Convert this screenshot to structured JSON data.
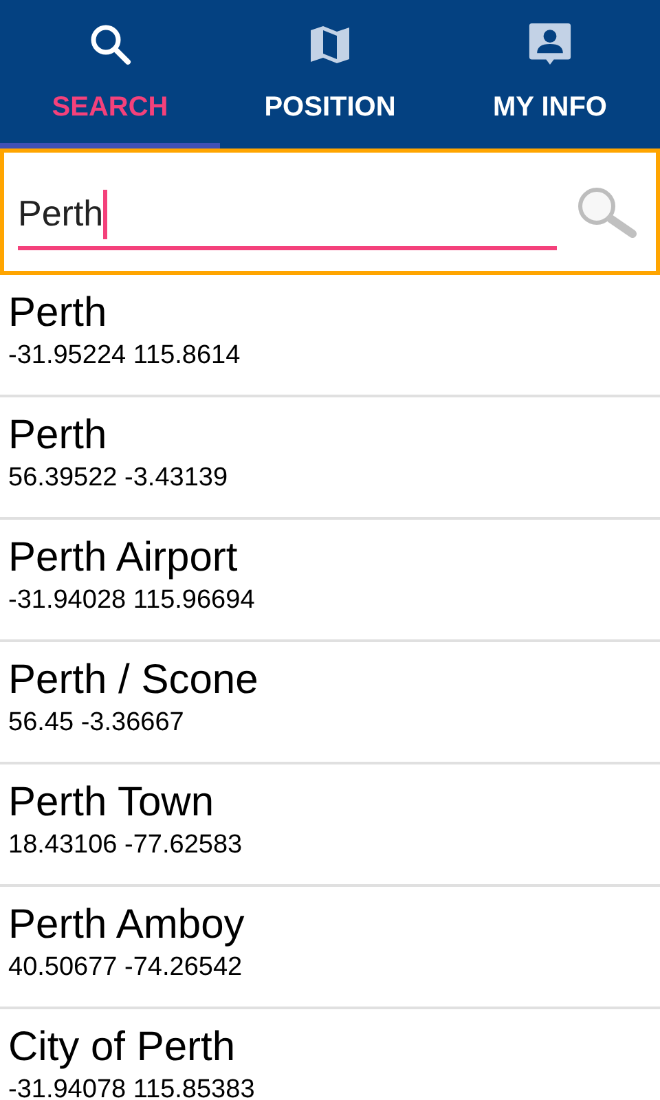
{
  "tabs": [
    {
      "label": "SEARCH",
      "kind": "search",
      "selected": true
    },
    {
      "label": "POSITION",
      "kind": "map",
      "selected": false
    },
    {
      "label": "MY INFO",
      "kind": "person",
      "selected": false
    }
  ],
  "search": {
    "value": "Perth",
    "focused": true
  },
  "results": [
    {
      "name": "Perth",
      "coords": "-31.95224 115.8614"
    },
    {
      "name": "Perth",
      "coords": "56.39522 -3.43139"
    },
    {
      "name": "Perth Airport",
      "coords": "-31.94028 115.96694"
    },
    {
      "name": "Perth / Scone",
      "coords": "56.45 -3.36667"
    },
    {
      "name": "Perth Town",
      "coords": "18.43106 -77.62583"
    },
    {
      "name": "Perth Amboy",
      "coords": "40.50677 -74.26542"
    },
    {
      "name": "City of Perth",
      "coords": "-31.94078 115.85383"
    }
  ]
}
